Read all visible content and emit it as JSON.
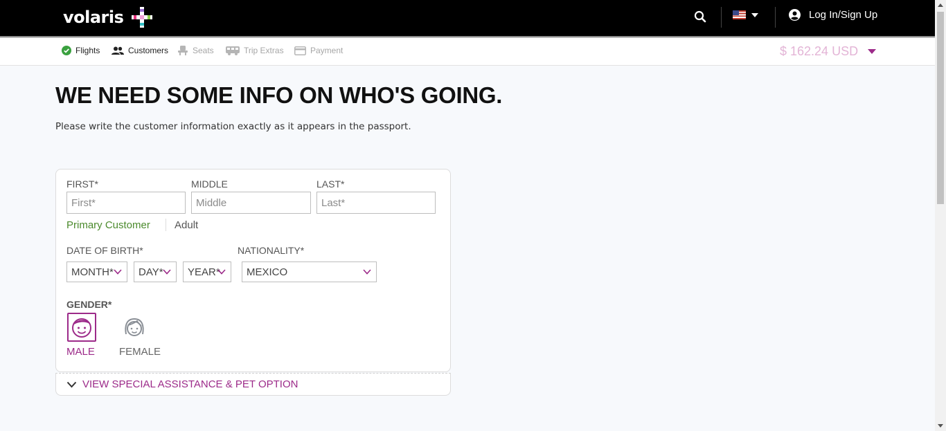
{
  "header": {
    "logo_text": "volaris",
    "search_icon": "search-icon",
    "language_flag": "us-flag-icon",
    "login_label": "Log In/Sign Up"
  },
  "steps": {
    "items": [
      {
        "label": "Flights",
        "icon": "check-circle-icon",
        "state": "done"
      },
      {
        "label": "Customers",
        "icon": "users-icon",
        "state": "current"
      },
      {
        "label": "Seats",
        "icon": "seat-icon",
        "state": "pending"
      },
      {
        "label": "Trip Extras",
        "icon": "bus-icon",
        "state": "pending"
      },
      {
        "label": "Payment",
        "icon": "card-icon",
        "state": "pending"
      }
    ],
    "price": "$ 162.24 USD"
  },
  "main": {
    "title": "WE NEED SOME INFO ON WHO'S GOING.",
    "subtitle": "Please write the customer information exactly as it appears in the passport."
  },
  "form": {
    "first_label": "FIRST*",
    "first_placeholder": "First*",
    "middle_label": "MIDDLE",
    "middle_placeholder": "Middle",
    "last_label": "LAST*",
    "last_placeholder": "Last*",
    "customer_tag": "Primary Customer",
    "passenger_type": "Adult",
    "dob_label": "DATE OF BIRTH*",
    "month_value": "MONTH*",
    "day_value": "DAY*",
    "year_value": "YEAR*",
    "nationality_label": "NATIONALITY*",
    "nationality_value": "MEXICO",
    "gender_label": "GENDER*",
    "male_label": "MALE",
    "female_label": "FEMALE",
    "selected_gender": "MALE"
  },
  "assistance": {
    "label": "VIEW SPECIAL ASSISTANCE & PET OPTION"
  },
  "colors": {
    "brand_purple": "#9c2a89",
    "success_green": "#4b8a2c",
    "price_pink": "#e3b4d6",
    "topbar_black": "#000000"
  }
}
